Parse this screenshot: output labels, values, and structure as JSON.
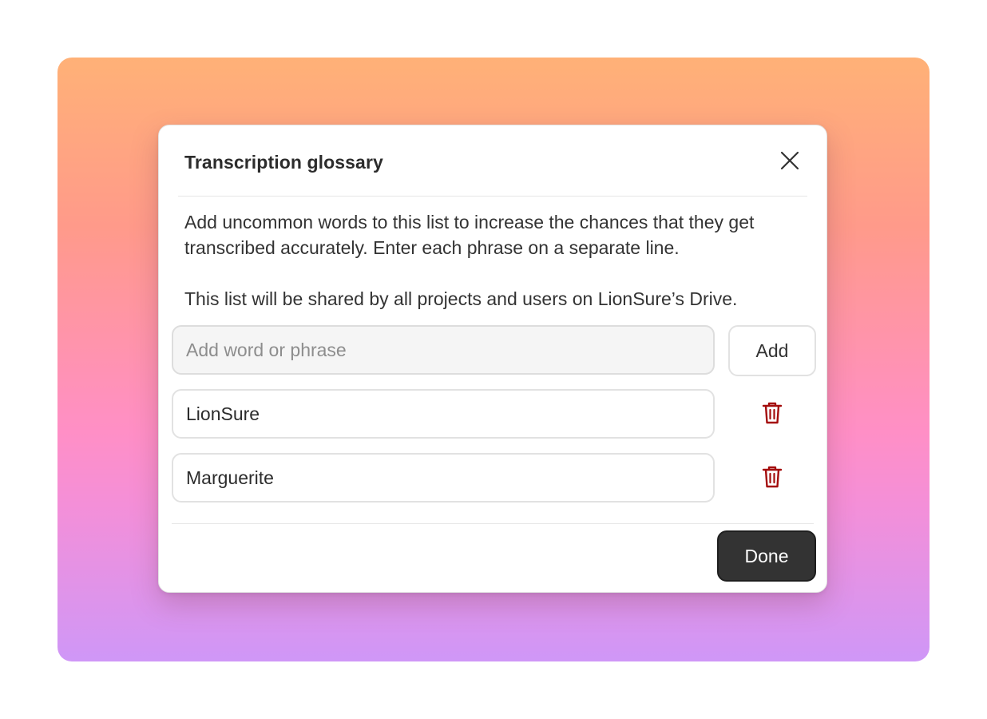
{
  "dialog": {
    "title": "Transcription glossary",
    "close_icon": "close-icon",
    "description": [
      "Add uncommon words to this list to increase the chances that they get transcribed accurately. Enter each phrase on a separate line.",
      "This list will be shared by all projects and users on LionSure’s Drive."
    ],
    "add_input": {
      "value": "",
      "placeholder": "Add word or phrase"
    },
    "add_button_label": "Add",
    "entries": [
      {
        "value": "LionSure",
        "delete_icon": "trash-icon"
      },
      {
        "value": "Marguerite",
        "delete_icon": "trash-icon"
      }
    ],
    "done_button_label": "Done"
  },
  "colors": {
    "delete_icon": "#a40d0d",
    "primary_button_bg": "#333333",
    "gradient_top": "#ffb177",
    "gradient_middle": "#ff8fc6",
    "gradient_bottom": "#cf97f7"
  }
}
